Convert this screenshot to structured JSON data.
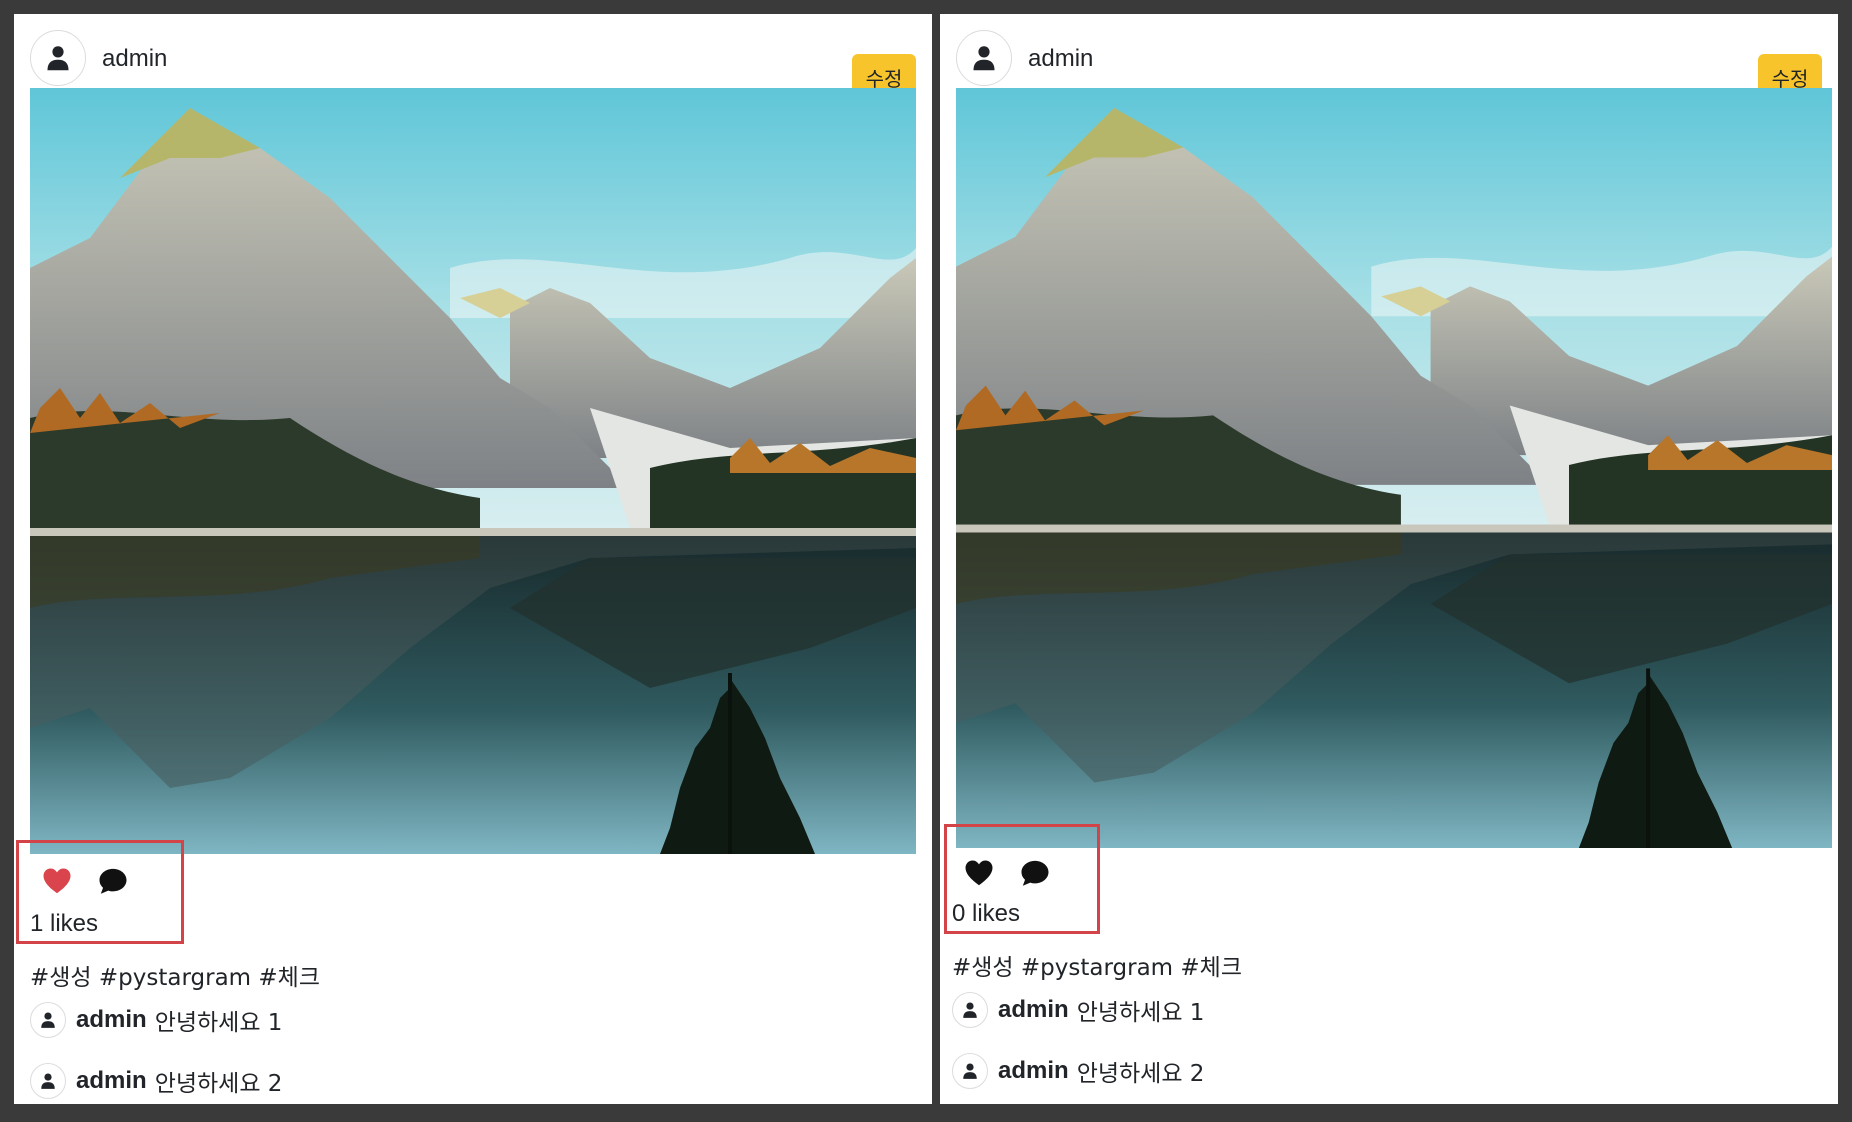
{
  "posts": [
    {
      "author": "admin",
      "edit_label": "수정",
      "liked": true,
      "likes_text": "1 likes",
      "tags": "#생성 #pystargram #체크",
      "comments": [
        {
          "user": "admin",
          "text": "안녕하세요 1"
        },
        {
          "user": "admin",
          "text": "안녕하세요 2"
        }
      ]
    },
    {
      "author": "admin",
      "edit_label": "수정",
      "liked": false,
      "likes_text": "0 likes",
      "tags": "#생성 #pystargram #체크",
      "comments": [
        {
          "user": "admin",
          "text": "안녕하세요 1"
        },
        {
          "user": "admin",
          "text": "안녕하세요 2"
        }
      ]
    }
  ],
  "colors": {
    "edit_button": "#f7c52b",
    "liked_heart": "#d9444d",
    "unliked_heart": "#111111",
    "highlight_box": "#d24447"
  },
  "icons": {
    "avatar": "person-icon",
    "like": "heart-icon",
    "comment": "chat-bubble-icon"
  }
}
